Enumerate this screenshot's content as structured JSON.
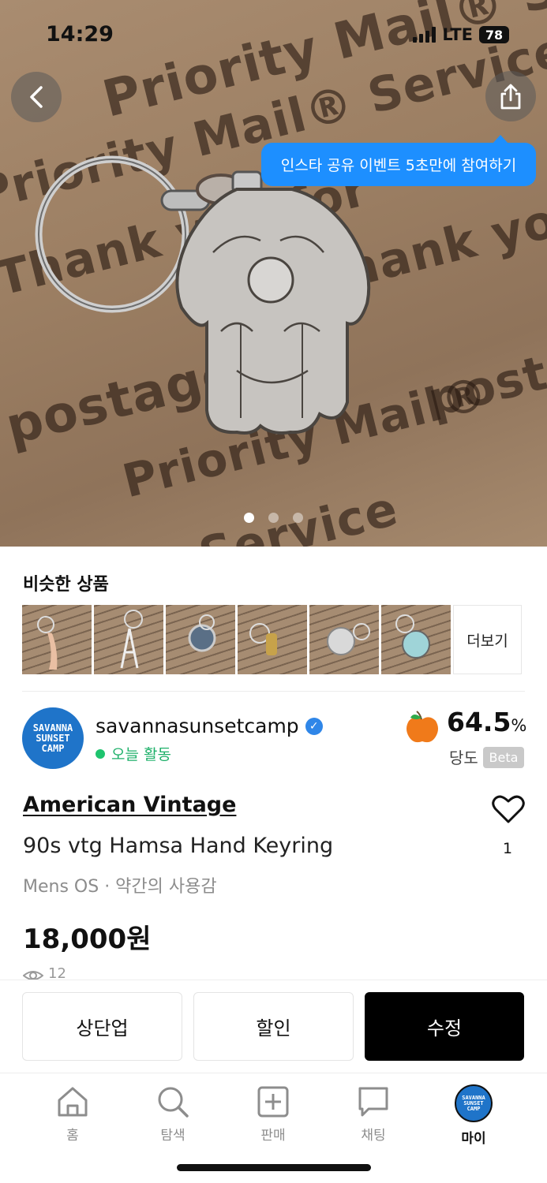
{
  "status_bar": {
    "time": "14:29",
    "network": "LTE",
    "battery": "78"
  },
  "hero": {
    "share_tooltip": "인스타 공유 이벤트 5초만에 참여하기",
    "photo_text": [
      "Priority Mail® Service",
      "Thank you for",
      "Priority Mail®",
      "postage",
      "Service"
    ],
    "page_count": 3,
    "active_page": 1
  },
  "similar": {
    "title": "비슷한 상품",
    "more_label": "더보기",
    "thumbnails": [
      "similar-item-1",
      "similar-item-2",
      "similar-item-3",
      "similar-item-4",
      "similar-item-5",
      "similar-item-6"
    ]
  },
  "seller": {
    "avatar_lines": [
      "SAVANNA",
      "SUNSET",
      "CAMP"
    ],
    "name": "savannasunsetcamp",
    "activity": "오늘 활동",
    "score": "64.5",
    "score_unit": "%",
    "score_label": "당도",
    "beta": "Beta"
  },
  "product": {
    "brand": "American Vintage",
    "title": "90s vtg Hamsa Hand Keyring",
    "meta": "Mens OS · 약간의 사용감",
    "price": "18,000원",
    "likes": "1",
    "views": "12"
  },
  "actions": {
    "bump": "상단업",
    "discount": "할인",
    "edit": "수정"
  },
  "tabs": [
    {
      "label": "홈",
      "icon": "home-icon"
    },
    {
      "label": "탐색",
      "icon": "search-icon"
    },
    {
      "label": "판매",
      "icon": "plus-square-icon"
    },
    {
      "label": "채팅",
      "icon": "chat-icon"
    },
    {
      "label": "마이",
      "icon": "avatar"
    }
  ],
  "colors": {
    "accent_blue": "#1d8fff",
    "online_green": "#1eb06a",
    "primary_button": "#000000"
  }
}
